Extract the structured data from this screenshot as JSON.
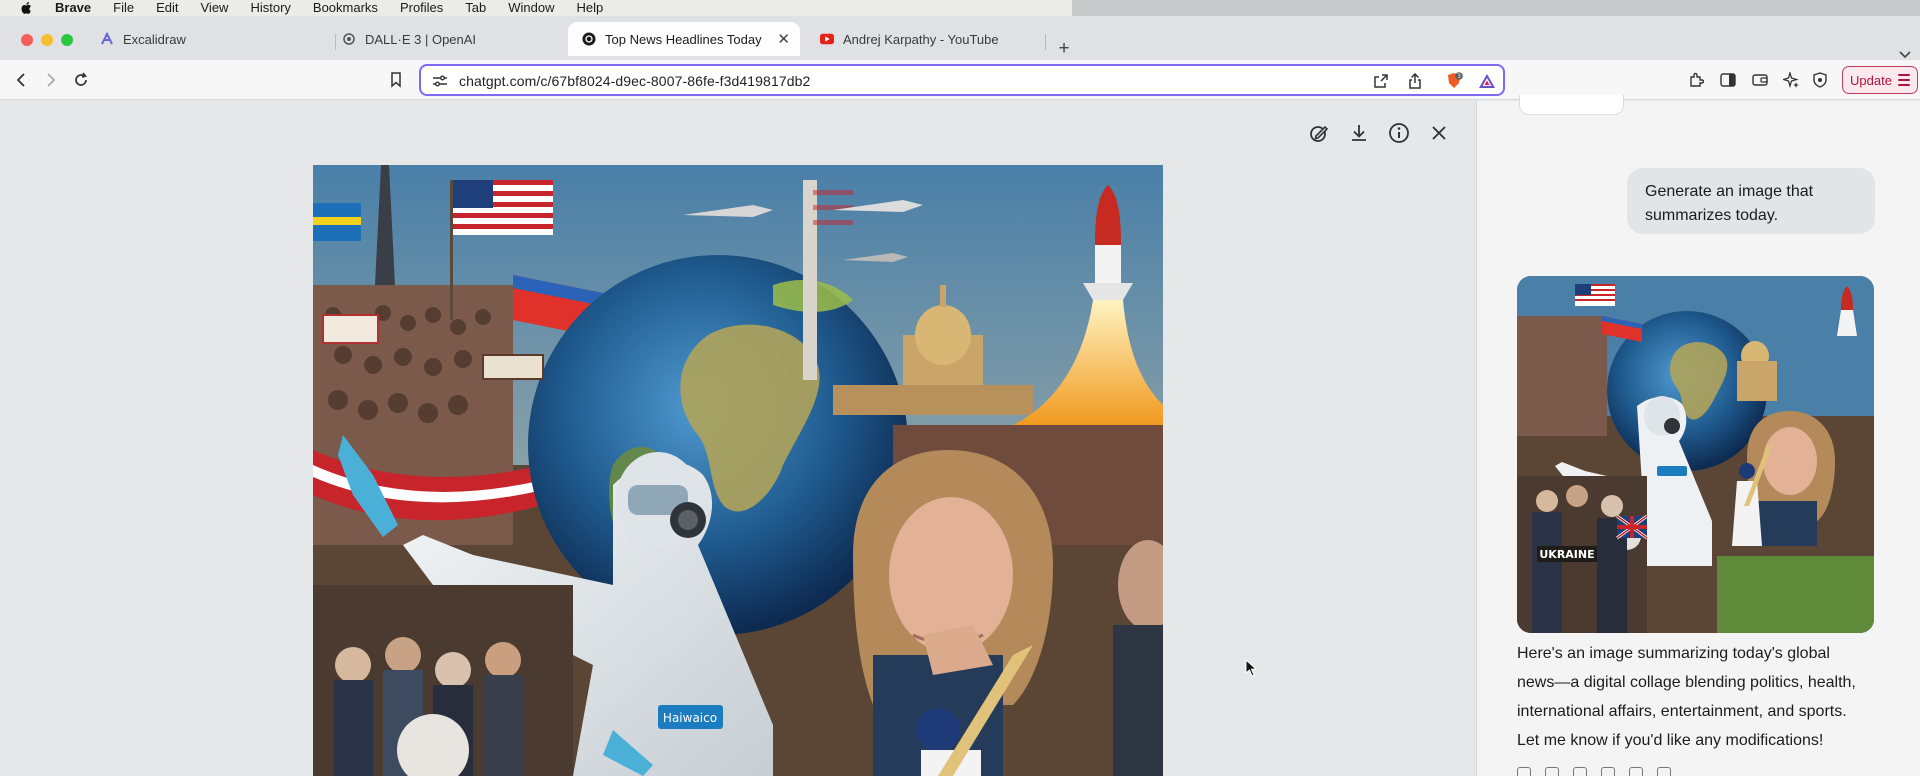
{
  "menubar": {
    "app": "Brave",
    "items": [
      "File",
      "Edit",
      "View",
      "History",
      "Bookmarks",
      "Profiles",
      "Tab",
      "Window",
      "Help"
    ]
  },
  "tabs": [
    {
      "title": "Excalidraw",
      "icon": "excalidraw-icon",
      "active": false
    },
    {
      "title": "DALL·E 3 | OpenAI",
      "icon": "openai-icon",
      "active": false
    },
    {
      "title": "Top News Headlines Today",
      "icon": "chatgpt-icon",
      "active": true
    },
    {
      "title": "Andrej Karpathy - YouTube",
      "icon": "youtube-icon",
      "active": false
    }
  ],
  "toolbar": {
    "url": "chatgpt.com/c/67bf8024-d9ec-8007-86fe-f3d419817db2",
    "shield_badge": "3",
    "update_label": "Update"
  },
  "chat": {
    "user_message": "Generate an image that summarizes today.",
    "assistant_reply": [
      "Here's an image summarizing today's global",
      "news—a digital collage blending politics, health,",
      "international affairs, entertainment, and sports.",
      "Let me know if you'd like any modifications!"
    ],
    "image_text": "UKRAINE"
  },
  "image": {
    "badge_text": "Haiwaico"
  },
  "colors": {
    "accent": "#7c6cf2",
    "update": "#c23a62",
    "traffic_red": "#f35f57",
    "traffic_yellow": "#f6be2f",
    "traffic_green": "#29c840"
  }
}
